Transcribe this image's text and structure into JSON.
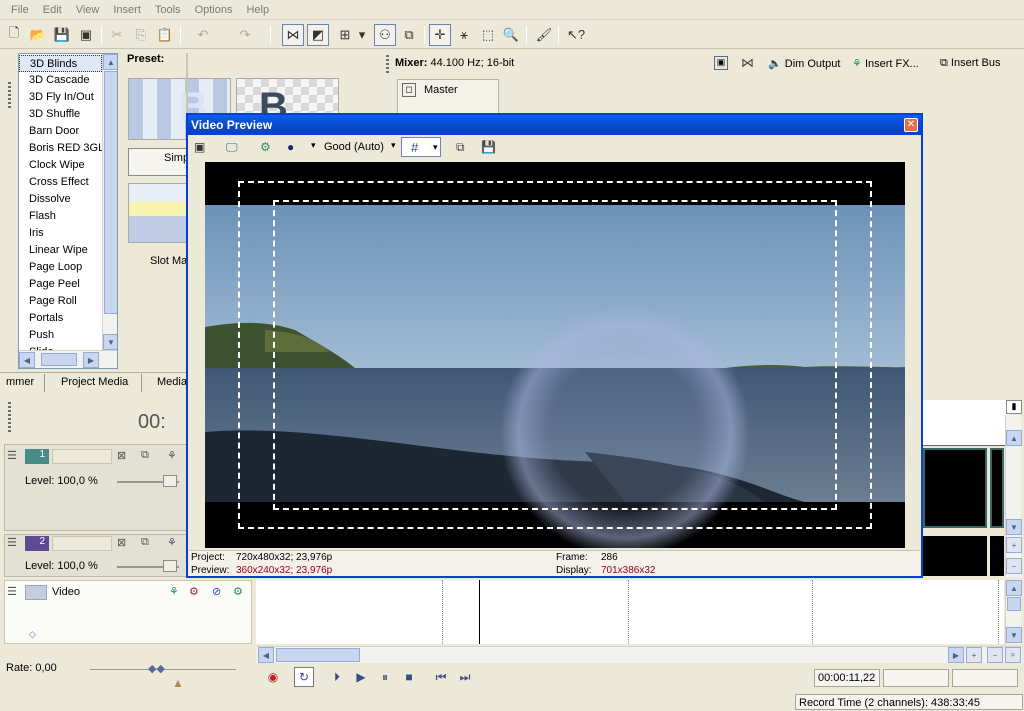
{
  "menu": [
    "File",
    "Edit",
    "View",
    "Insert",
    "Tools",
    "Options",
    "Help"
  ],
  "transitions": {
    "items": [
      "3D Blinds",
      "3D Cascade",
      "3D Fly In/Out",
      "3D Shuffle",
      "Barn Door",
      "Boris RED 3GL",
      "Clock Wipe",
      "Cross Effect",
      "Dissolve",
      "Flash",
      "Iris",
      "Linear Wipe",
      "Page Loop",
      "Page Peel",
      "Page Roll",
      "Portals",
      "Push",
      "Slide"
    ],
    "selected_index": 0,
    "preset_label": "Preset:",
    "preset_captions": [
      "Simp",
      "Slot Mac"
    ]
  },
  "tabs": [
    "mmer",
    "Project Media",
    "Media"
  ],
  "mixer": {
    "info_label": "Mixer:",
    "info_value": "44.100 Hz; 16-bit",
    "dim_output": "Dim Output",
    "insert_fx": "Insert FX...",
    "insert_bus": "Insert Bus",
    "master": "Master"
  },
  "preview": {
    "title": "Video Preview",
    "quality": "Good (Auto)",
    "project_label": "Project:",
    "project_value": "720x480x32; 23,976p",
    "preview_label": "Preview:",
    "preview_value": "360x240x32; 23,976p",
    "frame_label": "Frame:",
    "frame_value": "286",
    "display_label": "Display:",
    "display_value": "701x386x32",
    "highlight_color": "#a0001a"
  },
  "timeline": {
    "time_partial": "00:",
    "track1_num": "1",
    "track1_level": "Level: 100,0 %",
    "track2_num": "2",
    "track2_level": "Level: 100,0 %",
    "video_bus": "Video",
    "rate": "Rate: 0,00"
  },
  "status": {
    "timecode": "00:00:11,22",
    "record_time": "Record Time (2 channels): 438:33:45"
  }
}
